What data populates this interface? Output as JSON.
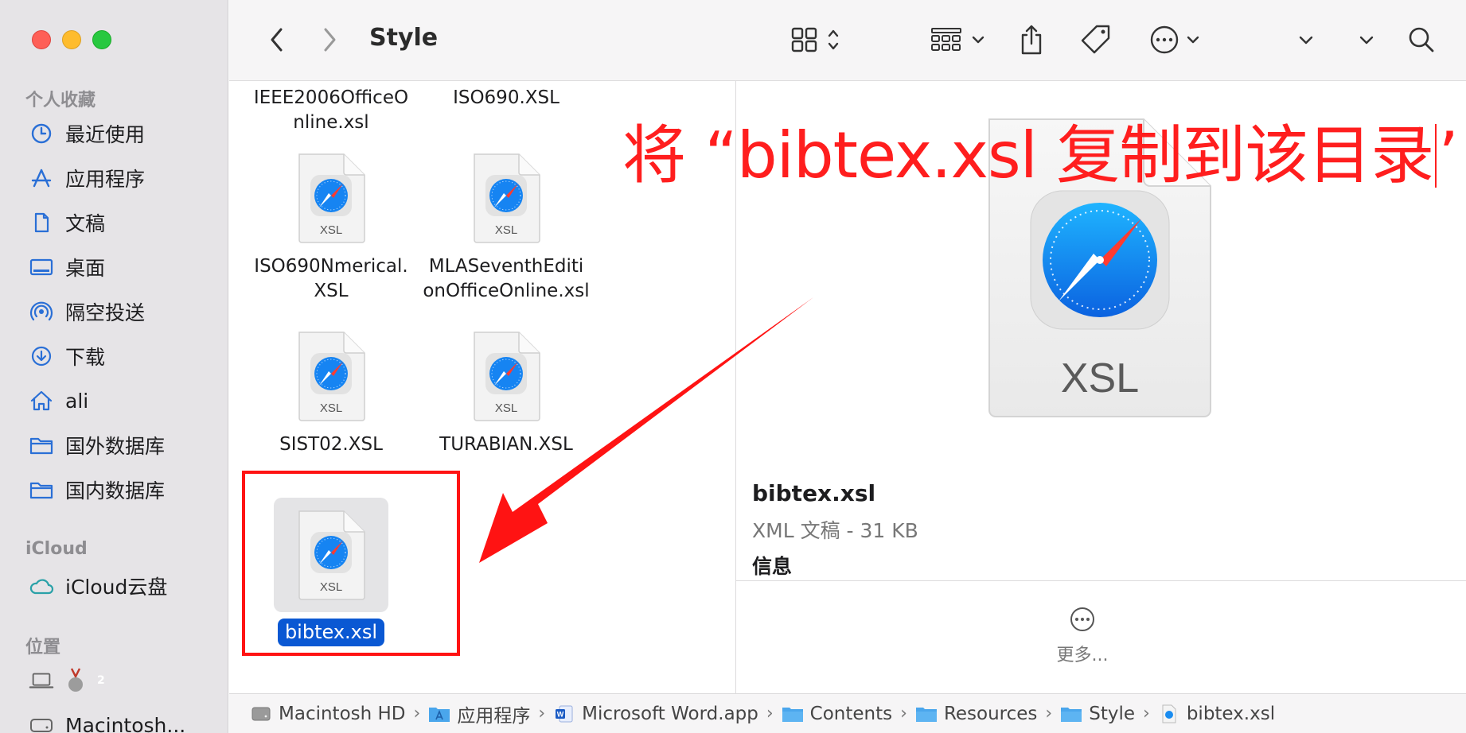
{
  "window": {
    "title": "Style"
  },
  "sidebar": {
    "favorites_title": "个人收藏",
    "favorites": [
      {
        "label": "最近使用",
        "icon": "clock-icon"
      },
      {
        "label": "应用程序",
        "icon": "app-store-icon"
      },
      {
        "label": "文稿",
        "icon": "document-icon"
      },
      {
        "label": "桌面",
        "icon": "desktop-icon"
      },
      {
        "label": "隔空投送",
        "icon": "airdrop-icon"
      },
      {
        "label": "下载",
        "icon": "download-icon"
      },
      {
        "label": "ali",
        "icon": "home-icon"
      },
      {
        "label": "国外数据库",
        "icon": "folder-icon"
      },
      {
        "label": "国内数据库",
        "icon": "folder-icon"
      }
    ],
    "icloud_title": "iCloud",
    "icloud": [
      {
        "label": "iCloud云盘",
        "icon": "cloud-icon"
      }
    ],
    "locations_title": "位置",
    "locations": [
      {
        "label": "",
        "icon": "laptop-icon",
        "badge": "2"
      },
      {
        "label": "Macintosh...",
        "icon": "disk-icon"
      }
    ]
  },
  "files": [
    {
      "name": "IEEE2006OfficeO\nnline.xsl"
    },
    {
      "name": "ISO690.XSL"
    },
    {
      "name": "ISO690Nmerical.\nXSL",
      "kind": "XSL"
    },
    {
      "name": "MLASeventhEditi\nonOfficeOnline.xsl",
      "kind": "XSL"
    },
    {
      "name": "SIST02.XSL",
      "kind": "XSL"
    },
    {
      "name": "TURABIAN.XSL",
      "kind": "XSL"
    },
    {
      "name": "bibtex.xsl",
      "kind": "XSL",
      "selected": true
    }
  ],
  "preview": {
    "icon_label": "XSL",
    "file_name": "bibtex.xsl",
    "file_kind": "XML 文稿 - 31 KB",
    "info_title": "信息",
    "more_label": "更多..."
  },
  "pathbar": [
    {
      "label": "Macintosh HD",
      "icon": "disk-icon"
    },
    {
      "label": "应用程序",
      "icon": "folder-apps-icon"
    },
    {
      "label": "Microsoft Word.app",
      "icon": "word-app-icon"
    },
    {
      "label": "Contents",
      "icon": "folder-icon"
    },
    {
      "label": "Resources",
      "icon": "folder-icon"
    },
    {
      "label": "Style",
      "icon": "folder-icon"
    },
    {
      "label": "bibtex.xsl",
      "icon": "xsl-file-icon"
    }
  ],
  "annotation": {
    "text_part1": "将 “bibtex.xsl 复制到该目录",
    "text_part2": "’",
    "color": "#ff1e1e"
  },
  "colors": {
    "selection": "#0a58d3",
    "sidebar_icon": "#2a6fd6",
    "annotation": "#ff1e1e"
  }
}
